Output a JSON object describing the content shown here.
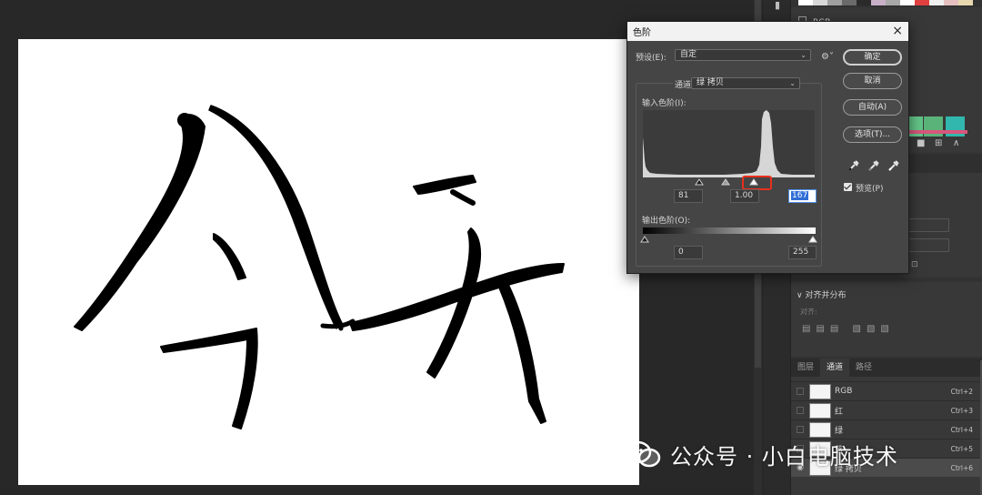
{
  "levels_dialog": {
    "title": "色阶",
    "preset_label": "预设(E):",
    "preset_value": "自定",
    "channel_label": "通道:",
    "channel_value": "绿 拷贝",
    "input_levels_label": "输入色阶(I):",
    "input_black": "81",
    "input_gamma": "1.00",
    "input_white": "167",
    "output_levels_label": "输出色阶(O):",
    "output_black": "0",
    "output_white": "255",
    "ok_label": "确定",
    "cancel_label": "取消",
    "auto_label": "自动(A)",
    "options_label": "选项(T)...",
    "preview_label": "预览(P)",
    "preview_checked": true
  },
  "color_panel": {
    "group_label": "RGB",
    "swatch_colors": [
      "#ffffff",
      "#000000",
      "#ff3030",
      "#2c6cd3",
      "#8c8c8c",
      "#5d9dd6",
      "#c8a8d8",
      "#ffffff",
      "#ff2020",
      "#e8e8e8",
      "#d0d0d0",
      "#f0e8d0"
    ],
    "palette_colors": [
      "#5fcc8a",
      "#59b97a",
      "#2fb8b0"
    ]
  },
  "align_panel": {
    "title": "对齐并分布",
    "align_label": "对齐:"
  },
  "channels_panel": {
    "tabs": [
      {
        "label": "图层",
        "active": false
      },
      {
        "label": "通道",
        "active": true
      },
      {
        "label": "路径",
        "active": false
      }
    ],
    "rows": [
      {
        "name": "RGB",
        "shortcut": "Ctrl+2",
        "visible": false,
        "selected": false
      },
      {
        "name": "红",
        "shortcut": "Ctrl+3",
        "visible": false,
        "selected": false
      },
      {
        "name": "绿",
        "shortcut": "Ctrl+4",
        "visible": false,
        "selected": false
      },
      {
        "name": "蓝",
        "shortcut": "Ctrl+5",
        "visible": false,
        "selected": false
      },
      {
        "name": "绿 拷贝",
        "shortcut": "Ctrl+6",
        "visible": true,
        "selected": true
      }
    ]
  },
  "watermark": {
    "text": "公众号 · 小白电脑技术"
  }
}
